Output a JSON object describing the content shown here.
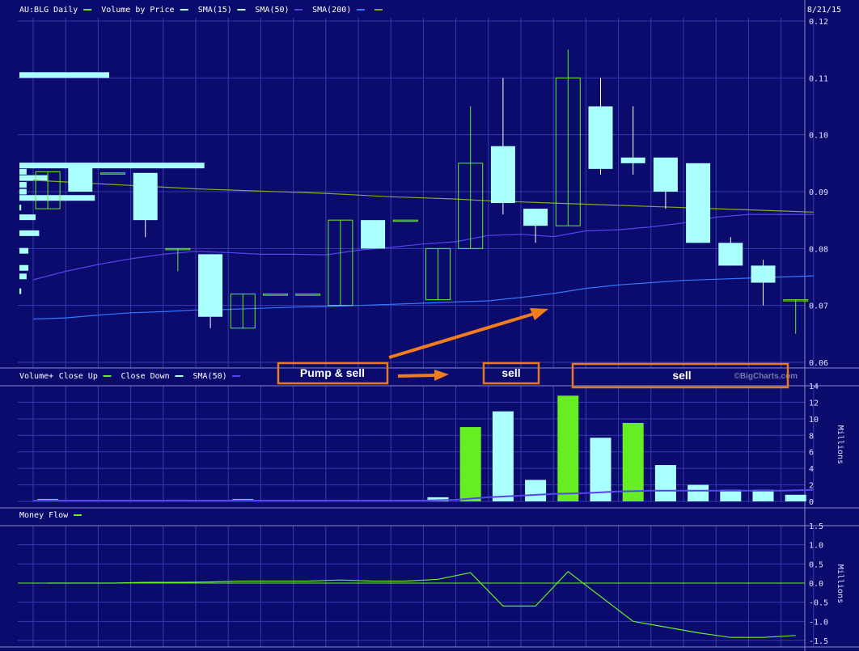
{
  "price_panel": {
    "legend": [
      {
        "label": "AU:BLG Daily",
        "color": "#66ee22"
      },
      {
        "label": "Volume by Price",
        "color": "#aaffff"
      },
      {
        "label": "SMA(15)",
        "color": "#aaffff"
      },
      {
        "label": "SMA(50)",
        "color": "#5544ee"
      },
      {
        "label": "SMA(200)",
        "color": "#3377ff"
      },
      {
        "label": "",
        "color": "#88aa22"
      }
    ],
    "date": "8/21/15",
    "watermark": "©BigCharts.com",
    "yticks": [
      "0.12",
      "0.11",
      "0.10",
      "0.09",
      "0.08",
      "0.07",
      "0.06"
    ]
  },
  "volume_panel": {
    "legend": [
      {
        "label": "Volume+",
        "color": null
      },
      {
        "label": "Close Up",
        "color": "#66ee22"
      },
      {
        "label": "Close Down",
        "color": "#aaffff"
      },
      {
        "label": "SMA(50)",
        "color": "#5544ee"
      }
    ],
    "yticks": [
      "14",
      "12",
      "10",
      "8",
      "6",
      "4",
      "2",
      "0"
    ],
    "unit": "Millions"
  },
  "flow_panel": {
    "legend": [
      {
        "label": "Money Flow",
        "color": "#66ee22"
      }
    ],
    "yticks": [
      "1.5",
      "1.0",
      "0.5",
      "0.0",
      "-0.5",
      "-1.0",
      "-1.5"
    ],
    "unit": "Millions"
  },
  "annotations": {
    "pump": "Pump & sell",
    "sell1": "sell",
    "sell2": "sell"
  },
  "chart_data": {
    "type": "candlestick",
    "ticker": "AU:BLG",
    "last_date": "8/21/15",
    "price_range": [
      0.06,
      0.12
    ],
    "candles": [
      {
        "o": 0.087,
        "h": 0.0935,
        "l": 0.087,
        "c": 0.0935,
        "up": true
      },
      {
        "o": 0.095,
        "h": 0.095,
        "l": 0.09,
        "c": 0.09,
        "up": false
      },
      {
        "o": 0.0933,
        "h": 0.0933,
        "l": 0.0933,
        "c": 0.0933,
        "up": true
      },
      {
        "o": 0.0933,
        "h": 0.0933,
        "l": 0.082,
        "c": 0.085,
        "up": false
      },
      {
        "o": 0.08,
        "h": 0.08,
        "l": 0.076,
        "c": 0.08,
        "up": true
      },
      {
        "o": 0.079,
        "h": 0.079,
        "l": 0.066,
        "c": 0.068,
        "up": false
      },
      {
        "o": 0.066,
        "h": 0.072,
        "l": 0.066,
        "c": 0.072,
        "up": true
      },
      {
        "o": 0.072,
        "h": 0.072,
        "l": 0.072,
        "c": 0.072,
        "up": true
      },
      {
        "o": 0.072,
        "h": 0.072,
        "l": 0.072,
        "c": 0.072,
        "up": true
      },
      {
        "o": 0.07,
        "h": 0.085,
        "l": 0.07,
        "c": 0.085,
        "up": true
      },
      {
        "o": 0.085,
        "h": 0.085,
        "l": 0.08,
        "c": 0.08,
        "up": false
      },
      {
        "o": 0.085,
        "h": 0.085,
        "l": 0.085,
        "c": 0.085,
        "up": true
      },
      {
        "o": 0.071,
        "h": 0.08,
        "l": 0.071,
        "c": 0.08,
        "up": true
      },
      {
        "o": 0.08,
        "h": 0.105,
        "l": 0.08,
        "c": 0.095,
        "up": true
      },
      {
        "o": 0.098,
        "h": 0.11,
        "l": 0.086,
        "c": 0.088,
        "up": false
      },
      {
        "o": 0.087,
        "h": 0.087,
        "l": 0.081,
        "c": 0.084,
        "up": false
      },
      {
        "o": 0.084,
        "h": 0.115,
        "l": 0.084,
        "c": 0.11,
        "up": true
      },
      {
        "o": 0.105,
        "h": 0.11,
        "l": 0.093,
        "c": 0.094,
        "up": false
      },
      {
        "o": 0.096,
        "h": 0.105,
        "l": 0.093,
        "c": 0.095,
        "up": false
      },
      {
        "o": 0.096,
        "h": 0.096,
        "l": 0.087,
        "c": 0.09,
        "up": false
      },
      {
        "o": 0.095,
        "h": 0.095,
        "l": 0.081,
        "c": 0.081,
        "up": false
      },
      {
        "o": 0.081,
        "h": 0.082,
        "l": 0.077,
        "c": 0.077,
        "up": false
      },
      {
        "o": 0.077,
        "h": 0.078,
        "l": 0.07,
        "c": 0.074,
        "up": false
      },
      {
        "o": 0.071,
        "h": 0.071,
        "l": 0.065,
        "c": 0.071,
        "up": true
      }
    ],
    "sma50": [
      0.0745,
      0.076,
      0.0772,
      0.0782,
      0.079,
      0.0795,
      0.0793,
      0.079,
      0.079,
      0.0789,
      0.0797,
      0.0802,
      0.0808,
      0.0812,
      0.0823,
      0.0825,
      0.0821,
      0.0831,
      0.0833,
      0.0838,
      0.0845,
      0.0855,
      0.086,
      0.086,
      0.086
    ],
    "sma200": [
      0.0676,
      0.0678,
      0.0683,
      0.0687,
      0.0689,
      0.0692,
      0.0693,
      0.0695,
      0.0697,
      0.0698,
      0.07,
      0.0702,
      0.0704,
      0.0706,
      0.0708,
      0.0714,
      0.0721,
      0.073,
      0.0736,
      0.074,
      0.0744,
      0.0746,
      0.0748,
      0.075,
      0.0752
    ],
    "sma15": [
      0.092,
      0.0917,
      0.0914,
      0.0911,
      0.0908,
      0.0905,
      0.0903,
      0.0901,
      0.0899,
      0.0897,
      0.0894,
      0.0891,
      0.0889,
      0.0887,
      0.0884,
      0.0882,
      0.088,
      0.0878,
      0.0876,
      0.0874,
      0.0872,
      0.087,
      0.0868,
      0.0866,
      0.0864
    ],
    "volume_by_price": [
      {
        "price": 0.1105,
        "size": 1.0
      },
      {
        "price": 0.0946,
        "size": 2.06
      },
      {
        "price": 0.0935,
        "size": 0.08
      },
      {
        "price": 0.0924,
        "size": 0.31
      },
      {
        "price": 0.0912,
        "size": 0.08
      },
      {
        "price": 0.09,
        "size": 0.08
      },
      {
        "price": 0.0889,
        "size": 0.84
      },
      {
        "price": 0.0872,
        "size": 0.02
      },
      {
        "price": 0.0855,
        "size": 0.18
      },
      {
        "price": 0.0827,
        "size": 0.22
      },
      {
        "price": 0.0796,
        "size": 0.1
      },
      {
        "price": 0.0766,
        "size": 0.1
      },
      {
        "price": 0.0751,
        "size": 0.08
      },
      {
        "price": 0.0725,
        "size": 0.02
      }
    ],
    "volume": {
      "unit": "Millions",
      "range": [
        0,
        14
      ],
      "values": [
        0.3,
        0.1,
        0.1,
        0.1,
        0.2,
        0.1,
        0.3,
        0.1,
        0.1,
        0.2,
        0.1,
        0.1,
        0.5,
        9.0,
        10.9,
        2.6,
        12.8,
        7.7,
        9.5,
        4.4,
        2.0,
        1.4,
        1.4,
        0.8
      ],
      "up": [
        true,
        false,
        false,
        false,
        false,
        false,
        true,
        false,
        false,
        true,
        false,
        true,
        false,
        true,
        false,
        false,
        true,
        false,
        true,
        false,
        false,
        false,
        false,
        false
      ],
      "sma50": [
        0.1,
        0.1,
        0.1,
        0.1,
        0.1,
        0.1,
        0.1,
        0.1,
        0.1,
        0.1,
        0.1,
        0.1,
        0.1,
        0.2,
        0.5,
        0.7,
        0.9,
        1.0,
        1.2,
        1.3,
        1.3,
        1.3,
        1.3,
        1.3,
        1.4
      ]
    },
    "money_flow": {
      "unit": "Millions",
      "range": [
        -1.5,
        1.5
      ],
      "values": [
        0.0,
        0.0,
        0.0,
        0.02,
        0.02,
        0.03,
        0.05,
        0.05,
        0.05,
        0.08,
        0.05,
        0.05,
        0.1,
        0.27,
        -0.6,
        -0.6,
        0.3,
        -0.35,
        -1.0,
        -1.15,
        -1.3,
        -1.42,
        -1.42,
        -1.37
      ]
    }
  }
}
